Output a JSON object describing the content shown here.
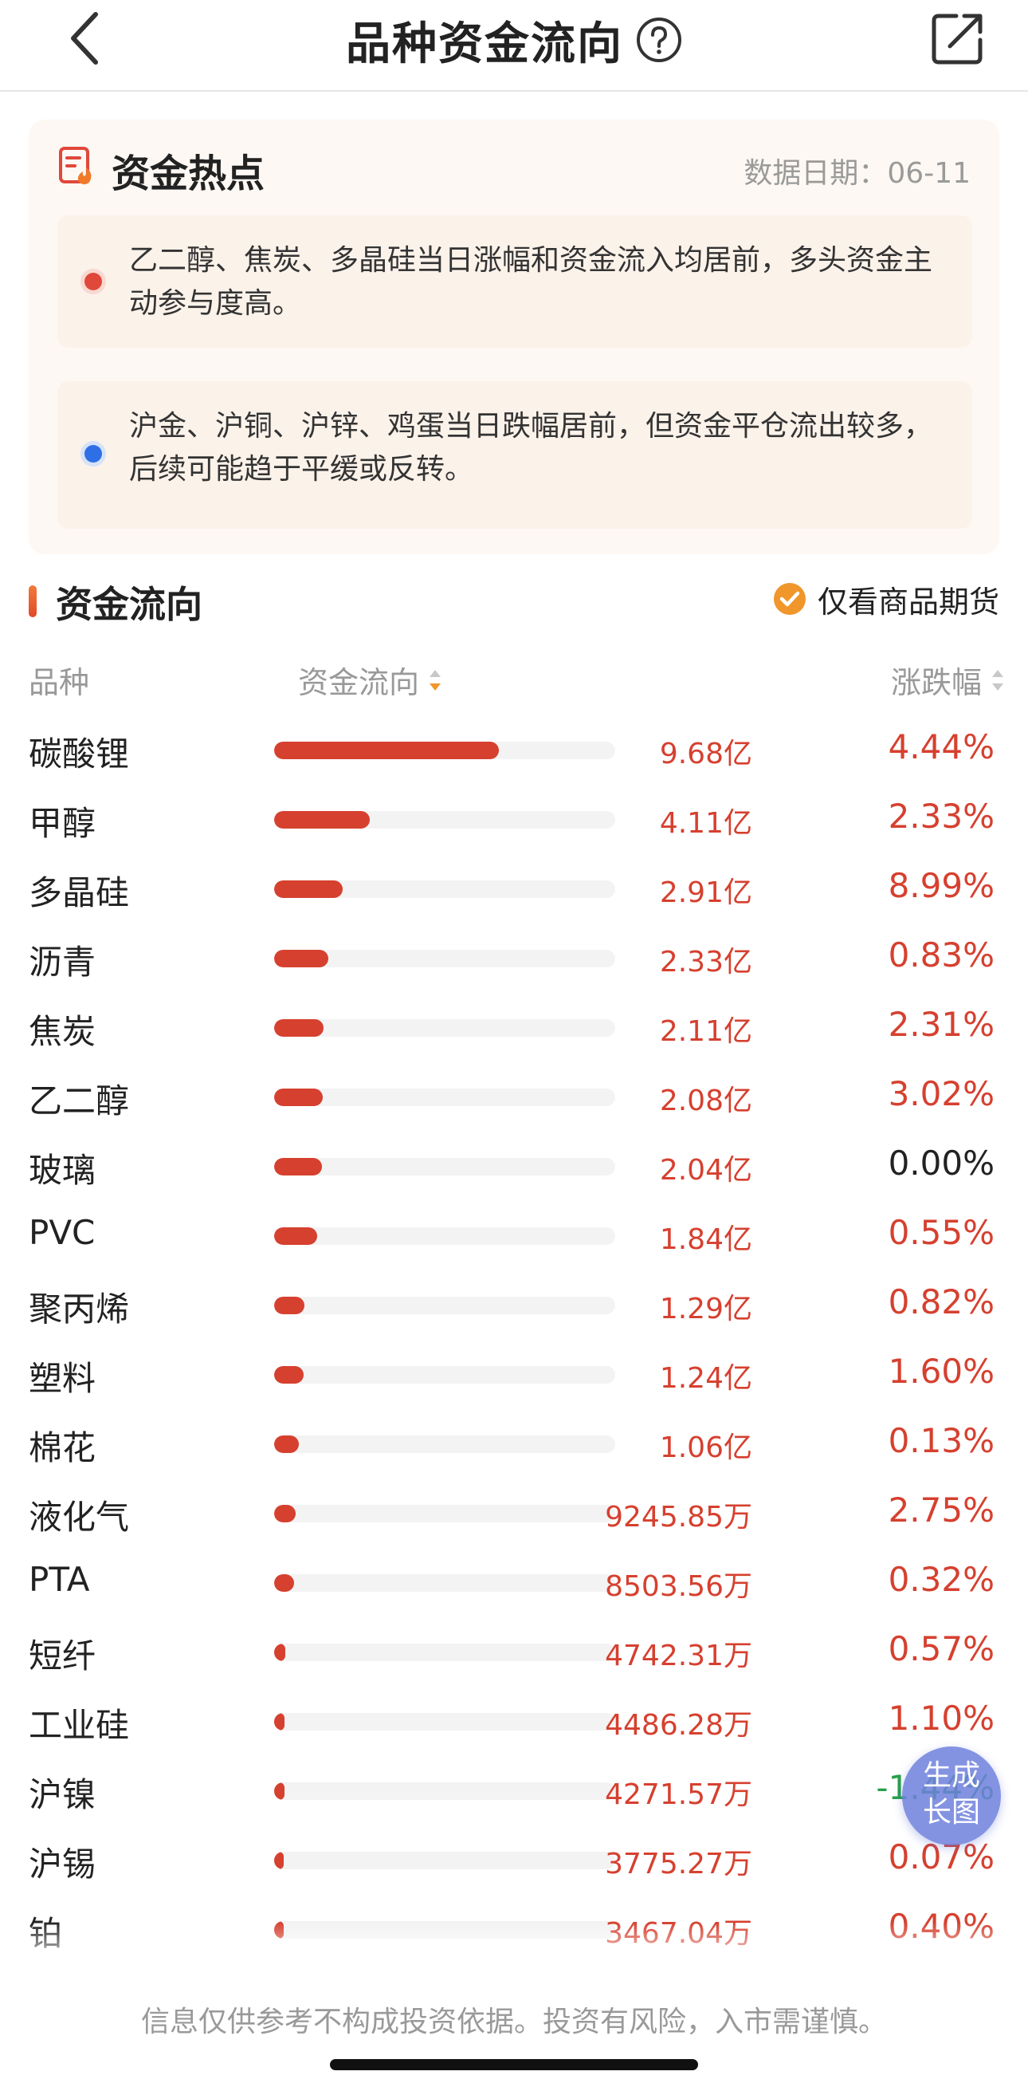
{
  "header": {
    "title": "品种资金流向",
    "back_icon": "chevron-left-icon",
    "help_icon": "question-circle-icon",
    "share_icon": "share-external-icon"
  },
  "hotspot": {
    "title": "资金热点",
    "date_label": "数据日期：06-11",
    "items": [
      {
        "dot_color": "#e0483a",
        "text": "乙二醇、焦炭、多晶硅当日涨幅和资金流入均居前，多头资金主动参与度高。"
      },
      {
        "dot_color": "#2f6fe6",
        "text": "沪金、沪铜、沪锌、鸡蛋当日跌幅居前，但资金平仓流出较多，后续可能趋于平缓或反转。"
      }
    ]
  },
  "flow": {
    "title": "资金流向",
    "filter_label": "仅看商品期货",
    "filter_checked": true,
    "columns": {
      "name": "品种",
      "flow": "资金流向",
      "change": "涨跌幅"
    },
    "rows": [
      {
        "name": "碳酸锂",
        "amount": "9.68亿",
        "bar": 0.66,
        "change": "4.44%",
        "dir": "up"
      },
      {
        "name": "甲醇",
        "amount": "4.11亿",
        "bar": 0.28,
        "change": "2.33%",
        "dir": "up"
      },
      {
        "name": "多晶硅",
        "amount": "2.91亿",
        "bar": 0.2,
        "change": "8.99%",
        "dir": "up"
      },
      {
        "name": "沥青",
        "amount": "2.33亿",
        "bar": 0.16,
        "change": "0.83%",
        "dir": "up"
      },
      {
        "name": "焦炭",
        "amount": "2.11亿",
        "bar": 0.145,
        "change": "2.31%",
        "dir": "up"
      },
      {
        "name": "乙二醇",
        "amount": "2.08亿",
        "bar": 0.143,
        "change": "3.02%",
        "dir": "up"
      },
      {
        "name": "玻璃",
        "amount": "2.04亿",
        "bar": 0.14,
        "change": "0.00%",
        "dir": "flat"
      },
      {
        "name": "PVC",
        "amount": "1.84亿",
        "bar": 0.127,
        "change": "0.55%",
        "dir": "up"
      },
      {
        "name": "聚丙烯",
        "amount": "1.29亿",
        "bar": 0.089,
        "change": "0.82%",
        "dir": "up"
      },
      {
        "name": "塑料",
        "amount": "1.24亿",
        "bar": 0.086,
        "change": "1.60%",
        "dir": "up"
      },
      {
        "name": "棉花",
        "amount": "1.06亿",
        "bar": 0.073,
        "change": "0.13%",
        "dir": "up"
      },
      {
        "name": "液化气",
        "amount": "9245.85万",
        "bar": 0.064,
        "change": "2.75%",
        "dir": "up"
      },
      {
        "name": "PTA",
        "amount": "8503.56万",
        "bar": 0.059,
        "change": "0.32%",
        "dir": "up"
      },
      {
        "name": "短纤",
        "amount": "4742.31万",
        "bar": 0.033,
        "change": "0.57%",
        "dir": "up"
      },
      {
        "name": "工业硅",
        "amount": "4486.28万",
        "bar": 0.031,
        "change": "1.10%",
        "dir": "up"
      },
      {
        "name": "沪镍",
        "amount": "4271.57万",
        "bar": 0.03,
        "change": "-1.44%",
        "dir": "down"
      },
      {
        "name": "沪锡",
        "amount": "3775.27万",
        "bar": 0.026,
        "change": "0.07%",
        "dir": "up"
      },
      {
        "name": "铂",
        "amount": "3467.04万",
        "bar": 0.024,
        "change": "0.40%",
        "dir": "up"
      }
    ]
  },
  "fab": {
    "line1": "生成",
    "line2": "长图"
  },
  "footer": {
    "disclaimer": "信息仅供参考不构成投资依据。投资有风险，入市需谨慎。"
  }
}
